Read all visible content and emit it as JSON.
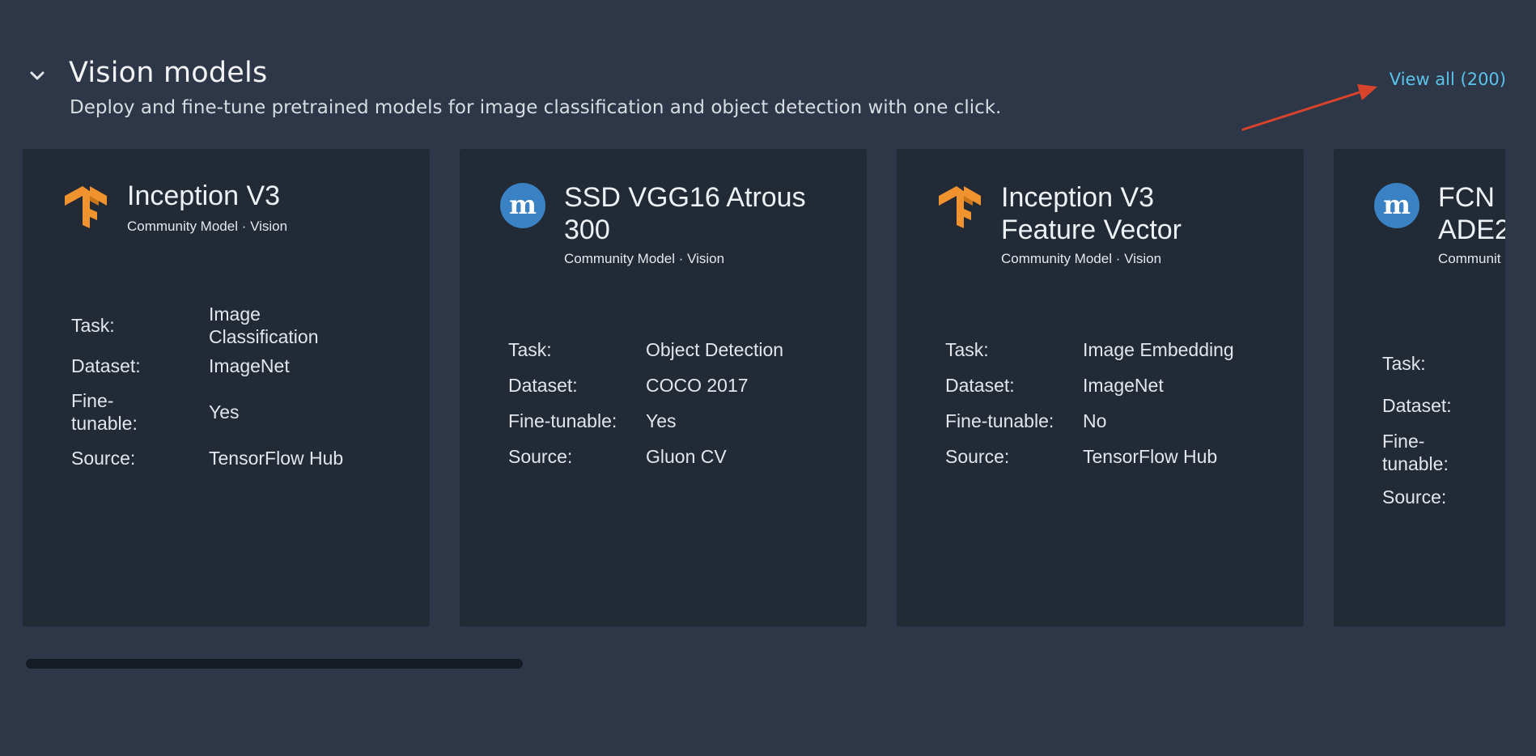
{
  "section": {
    "title": "Vision models",
    "subtitle": "Deploy and fine-tune pretrained models for image classification and object detection with one click.",
    "view_all": "View all (200)",
    "collapse_icon": "chevron-down-icon"
  },
  "colors": {
    "background": "#2e3747",
    "card": "#222a36",
    "link": "#5ac3ea",
    "tensorflow_orange": "#f0932e",
    "mxnet_blue": "#3b82c4",
    "annotation_arrow": "#d8432b"
  },
  "labels": {
    "task": "Task:",
    "dataset": "Dataset:",
    "fine_tunable": "Fine-tunable:",
    "fine_tunable_wrapped_1": "Fine-",
    "fine_tunable_wrapped_2": "tunable:",
    "source": "Source:"
  },
  "cards": [
    {
      "title": "Inception V3",
      "subtitle": "Community Model · Vision",
      "logo": "tensorflow-icon",
      "task": "Image Classification",
      "task_line1": "Image",
      "task_line2": "Classification",
      "dataset": "ImageNet",
      "fine_tunable": "Yes",
      "source": "TensorFlow Hub"
    },
    {
      "title_line1": "SSD VGG16 Atrous",
      "title_line2": "300",
      "subtitle": "Community Model · Vision",
      "logo": "mxnet-icon",
      "task": "Object Detection",
      "dataset": "COCO 2017",
      "fine_tunable": "Yes",
      "source": "Gluon CV"
    },
    {
      "title_line1": "Inception V3",
      "title_line2": "Feature Vector",
      "subtitle": "Community Model · Vision",
      "logo": "tensorflow-icon",
      "task": "Image Embedding",
      "dataset": "ImageNet",
      "fine_tunable": "No",
      "source": "TensorFlow Hub"
    },
    {
      "title_line1": "FCN",
      "title_line2": "ADE2",
      "subtitle": "Communit",
      "logo": "mxnet-icon"
    }
  ]
}
